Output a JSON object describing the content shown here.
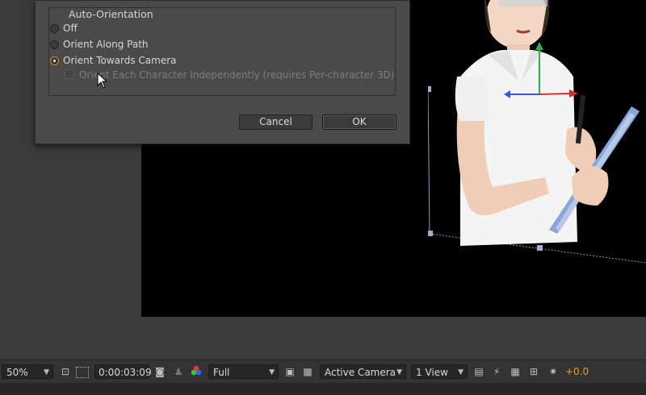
{
  "dialog": {
    "group_title": "Auto-Orientation",
    "options": [
      {
        "label": "Off",
        "selected": false
      },
      {
        "label": "Orient Along Path",
        "selected": false
      },
      {
        "label": "Orient Towards Camera",
        "selected": true
      }
    ],
    "checkbox_label": "Orient Each Character Independently (requires Per-character 3D)",
    "checkbox_checked": false,
    "cancel_label": "Cancel",
    "ok_label": "OK"
  },
  "toolbar": {
    "zoom": "50%",
    "timecode": "0:00:03:09",
    "resolution": "Full",
    "camera": "Active Camera",
    "views": "1 View",
    "exposure": "+0.0",
    "icons": [
      "region-of-interest-icon",
      "transparency-grid-icon",
      "snapshot-icon",
      "show-snapshot-icon",
      "color-channel-icon",
      "toggle-mask-icon",
      "checkerboard-icon",
      "grid-guides-icon",
      "fast-preview-icon",
      "timeline-icon",
      "flowchart-icon",
      "reset-exposure-icon"
    ]
  },
  "colors": {
    "accent": "#e8a020",
    "viewer_bg": "#000000",
    "panel_bg": "#3b3b3b"
  }
}
